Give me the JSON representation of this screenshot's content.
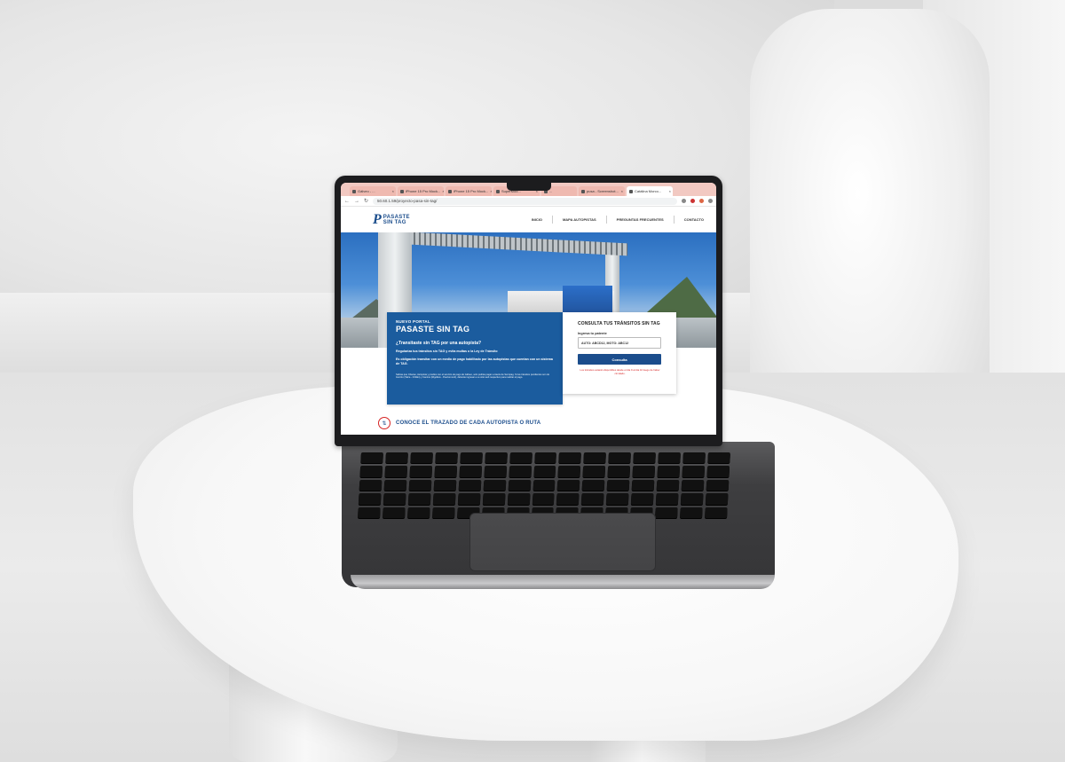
{
  "browser": {
    "tabs": [
      {
        "label": "Gálveo - ...",
        "active": false
      },
      {
        "label": "iPhone 15 Pro Mock...",
        "active": false
      },
      {
        "label": "iPhone 15 Pro Mock...",
        "active": false
      },
      {
        "label": "SuperMod...",
        "active": false
      },
      {
        "label": "...",
        "active": false
      },
      {
        "label": "pusa - Screenshot...",
        "active": false
      },
      {
        "label": "Catálina Morco...",
        "active": true
      }
    ],
    "url": "50.60.1.59/proyecto-pasa-sin-tag/"
  },
  "site": {
    "logo_line1": "PASASTE",
    "logo_line2": "SIN TAG",
    "menu": [
      "INICIO",
      "MAPA AUTOPISTAS",
      "PREGUNTAS FRECUENTES",
      "CONTACTO"
    ]
  },
  "promo": {
    "kicker": "NUEVO PORTAL",
    "title": "PASASTE SIN TAG",
    "question": "¿Transitaste sin TAG por una autopista?",
    "p1": "Regulariza tus tránsitos sin TAG y evita multas o la Ley de Tránsito",
    "p2": "Es obligación transitar con un medio de pago habilitado por las autopistas que cuentan con un sistema de TAG.",
    "small": "Sabías que Chacao, Autopista y predios con el servicio de pago de Gálveo, solo podrás pagar a través de Servipag. Si tus tránsitos pendientes son de Gorrión (Talca - Chillán) y Camino (Rigolleto - Puertomontt), deberás ingresar a su sitio web respectivo para realizar el pago."
  },
  "form": {
    "title": "CONSULTA TUS TRÁNSITOS SIN TAG",
    "label": "Ingresa tu patente",
    "placeholder": "AUTO: ABCD12, MOTO: ABC12",
    "button": "Consulta",
    "note": "Los tránsitos estarán disponibles desde el día 9 al día 10 luego de haber circulado."
  },
  "section2": {
    "title": "CONOCE EL TRAZADO DE CADA AUTOPISTA O RUTA"
  }
}
